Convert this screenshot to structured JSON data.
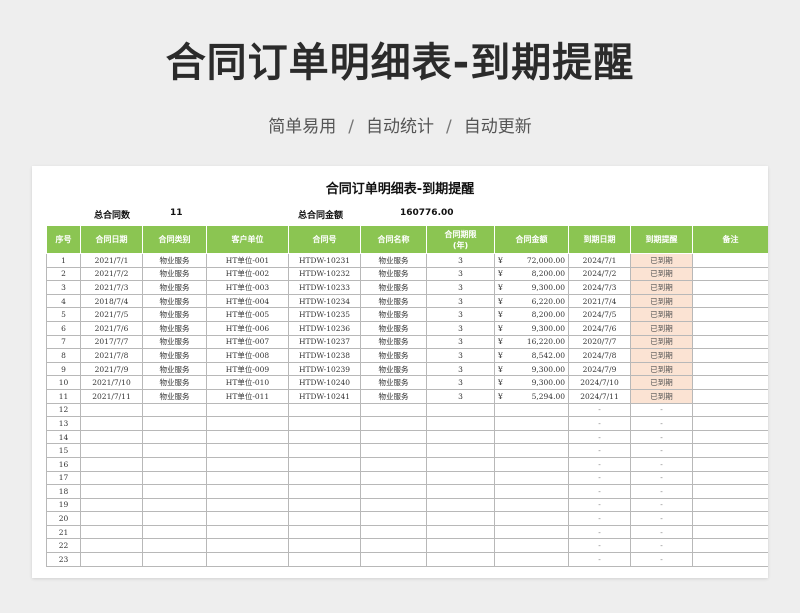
{
  "banner": {
    "title": "合同订单明细表-到期提醒",
    "features": [
      "简单易用",
      "自动统计",
      "自动更新"
    ],
    "separator": "/"
  },
  "sheet": {
    "title": "合同订单明细表-到期提醒",
    "summary": {
      "count_label": "总合同数",
      "count_value": "11",
      "amount_label": "总合同金额",
      "amount_value": "160776.00"
    },
    "columns": [
      "序号",
      "合同日期",
      "合同类别",
      "客户单位",
      "合同号",
      "合同名称",
      "合同期限\n(年)",
      "合同金额",
      "到期日期",
      "到期提醒",
      "备注"
    ],
    "currency_symbol": "¥",
    "rows": [
      {
        "no": "1",
        "date": "2021/7/1",
        "category": "物业服务",
        "client": "HT单位-001",
        "contract_no": "HTDW-10231",
        "name": "物业服务",
        "term": "3",
        "amount": "72,000.00",
        "due": "2024/7/1",
        "status": "已到期",
        "note": ""
      },
      {
        "no": "2",
        "date": "2021/7/2",
        "category": "物业服务",
        "client": "HT单位-002",
        "contract_no": "HTDW-10232",
        "name": "物业服务",
        "term": "3",
        "amount": "8,200.00",
        "due": "2024/7/2",
        "status": "已到期",
        "note": ""
      },
      {
        "no": "3",
        "date": "2021/7/3",
        "category": "物业服务",
        "client": "HT单位-003",
        "contract_no": "HTDW-10233",
        "name": "物业服务",
        "term": "3",
        "amount": "9,300.00",
        "due": "2024/7/3",
        "status": "已到期",
        "note": ""
      },
      {
        "no": "4",
        "date": "2018/7/4",
        "category": "物业服务",
        "client": "HT单位-004",
        "contract_no": "HTDW-10234",
        "name": "物业服务",
        "term": "3",
        "amount": "6,220.00",
        "due": "2021/7/4",
        "status": "已到期",
        "note": ""
      },
      {
        "no": "5",
        "date": "2021/7/5",
        "category": "物业服务",
        "client": "HT单位-005",
        "contract_no": "HTDW-10235",
        "name": "物业服务",
        "term": "3",
        "amount": "8,200.00",
        "due": "2024/7/5",
        "status": "已到期",
        "note": ""
      },
      {
        "no": "6",
        "date": "2021/7/6",
        "category": "物业服务",
        "client": "HT单位-006",
        "contract_no": "HTDW-10236",
        "name": "物业服务",
        "term": "3",
        "amount": "9,300.00",
        "due": "2024/7/6",
        "status": "已到期",
        "note": ""
      },
      {
        "no": "7",
        "date": "2017/7/7",
        "category": "物业服务",
        "client": "HT单位-007",
        "contract_no": "HTDW-10237",
        "name": "物业服务",
        "term": "3",
        "amount": "16,220.00",
        "due": "2020/7/7",
        "status": "已到期",
        "note": ""
      },
      {
        "no": "8",
        "date": "2021/7/8",
        "category": "物业服务",
        "client": "HT单位-008",
        "contract_no": "HTDW-10238",
        "name": "物业服务",
        "term": "3",
        "amount": "8,542.00",
        "due": "2024/7/8",
        "status": "已到期",
        "note": ""
      },
      {
        "no": "9",
        "date": "2021/7/9",
        "category": "物业服务",
        "client": "HT单位-009",
        "contract_no": "HTDW-10239",
        "name": "物业服务",
        "term": "3",
        "amount": "9,300.00",
        "due": "2024/7/9",
        "status": "已到期",
        "note": ""
      },
      {
        "no": "10",
        "date": "2021/7/10",
        "category": "物业服务",
        "client": "HT单位-010",
        "contract_no": "HTDW-10240",
        "name": "物业服务",
        "term": "3",
        "amount": "9,300.00",
        "due": "2024/7/10",
        "status": "已到期",
        "note": ""
      },
      {
        "no": "11",
        "date": "2021/7/11",
        "category": "物业服务",
        "client": "HT单位-011",
        "contract_no": "HTDW-10241",
        "name": "物业服务",
        "term": "3",
        "amount": "5,294.00",
        "due": "2024/7/11",
        "status": "已到期",
        "note": ""
      }
    ],
    "empty_rows": [
      "12",
      "13",
      "14",
      "15",
      "16",
      "17",
      "18",
      "19",
      "20",
      "21",
      "22",
      "23"
    ],
    "empty_placeholder": "-"
  },
  "colors": {
    "header_green": "#8bc552",
    "status_fill": "#fbe3d3"
  }
}
